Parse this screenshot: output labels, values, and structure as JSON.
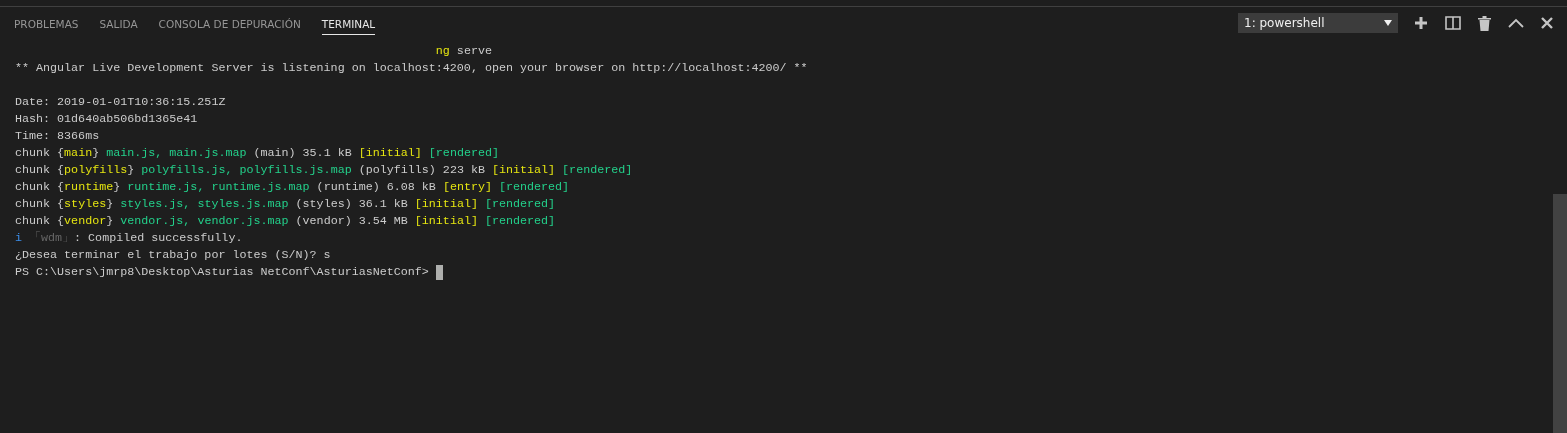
{
  "panel_tabs": [
    {
      "label": "PROBLEMAS",
      "selected": false
    },
    {
      "label": "SALIDA",
      "selected": false
    },
    {
      "label": "CONSOLA DE DEPURACIÓN",
      "selected": false
    },
    {
      "label": "TERMINAL",
      "selected": true
    }
  ],
  "terminal_select": {
    "value": "1: powershell"
  },
  "terminal_lines": [
    {
      "kind": "text",
      "segments": [
        {
          "text": "                                                            ng",
          "kind": "keyword"
        },
        {
          "text": " serve",
          "kind": "plain"
        }
      ]
    },
    {
      "kind": "text",
      "segments": [
        {
          "text": "** Angular Live Development Server is listening on localhost:4200, open your browser on http://localhost:4200/ **",
          "kind": "plain"
        }
      ]
    },
    {
      "kind": "blank"
    },
    {
      "kind": "text",
      "segments": [
        {
          "text": "Date: 2019-01-01T10:36:15.251Z",
          "kind": "plain"
        }
      ]
    },
    {
      "kind": "text",
      "segments": [
        {
          "text": "Hash: 01d640ab506bd1365e41",
          "kind": "plain"
        }
      ]
    },
    {
      "kind": "text",
      "segments": [
        {
          "text": "Time: 8366ms",
          "kind": "plain"
        }
      ]
    },
    {
      "kind": "text",
      "segments": [
        {
          "text": "chunk {",
          "kind": "plain"
        },
        {
          "text": "main",
          "kind": "keyword"
        },
        {
          "text": "} ",
          "kind": "plain"
        },
        {
          "text": "main.js, main.js.map",
          "kind": "file"
        },
        {
          "text": " (main) 35.1 kB ",
          "kind": "plain"
        },
        {
          "text": "[initial]",
          "kind": "keyword"
        },
        {
          "text": " [rendered]",
          "kind": "file"
        }
      ]
    },
    {
      "kind": "text",
      "segments": [
        {
          "text": "chunk {",
          "kind": "plain"
        },
        {
          "text": "polyfills",
          "kind": "keyword"
        },
        {
          "text": "} ",
          "kind": "plain"
        },
        {
          "text": "polyfills.js, polyfills.js.map",
          "kind": "file"
        },
        {
          "text": " (polyfills) 223 kB ",
          "kind": "plain"
        },
        {
          "text": "[initial]",
          "kind": "keyword"
        },
        {
          "text": " [rendered]",
          "kind": "file"
        }
      ]
    },
    {
      "kind": "text",
      "segments": [
        {
          "text": "chunk {",
          "kind": "plain"
        },
        {
          "text": "runtime",
          "kind": "keyword"
        },
        {
          "text": "} ",
          "kind": "plain"
        },
        {
          "text": "runtime.js, runtime.js.map",
          "kind": "file"
        },
        {
          "text": " (runtime) 6.08 kB ",
          "kind": "plain"
        },
        {
          "text": "[entry]",
          "kind": "keyword"
        },
        {
          "text": " [rendered]",
          "kind": "file"
        }
      ]
    },
    {
      "kind": "text",
      "segments": [
        {
          "text": "chunk {",
          "kind": "plain"
        },
        {
          "text": "styles",
          "kind": "keyword"
        },
        {
          "text": "} ",
          "kind": "plain"
        },
        {
          "text": "styles.js, styles.js.map",
          "kind": "file"
        },
        {
          "text": " (styles) 36.1 kB ",
          "kind": "plain"
        },
        {
          "text": "[initial]",
          "kind": "keyword"
        },
        {
          "text": " [rendered]",
          "kind": "file"
        }
      ]
    },
    {
      "kind": "text",
      "segments": [
        {
          "text": "chunk {",
          "kind": "plain"
        },
        {
          "text": "vendor",
          "kind": "keyword"
        },
        {
          "text": "} ",
          "kind": "plain"
        },
        {
          "text": "vendor.js, vendor.js.map",
          "kind": "file"
        },
        {
          "text": " (vendor) 3.54 MB ",
          "kind": "plain"
        },
        {
          "text": "[initial]",
          "kind": "keyword"
        },
        {
          "text": " [rendered]",
          "kind": "file"
        }
      ]
    },
    {
      "kind": "text",
      "segments": [
        {
          "text": "i ",
          "kind": "info"
        },
        {
          "text": "「wdm」",
          "kind": "dim"
        },
        {
          "text": ": Compiled successfully.",
          "kind": "plain"
        }
      ]
    },
    {
      "kind": "text",
      "segments": [
        {
          "text": "¿Desea terminar el trabajo por lotes (S/N)? s",
          "kind": "plain"
        }
      ]
    },
    {
      "kind": "prompt",
      "segments": [
        {
          "text": "PS C:\\Users\\jmrp8\\Desktop\\Asturias NetConf\\AsturiasNetConf> ",
          "kind": "plain"
        }
      ]
    }
  ]
}
